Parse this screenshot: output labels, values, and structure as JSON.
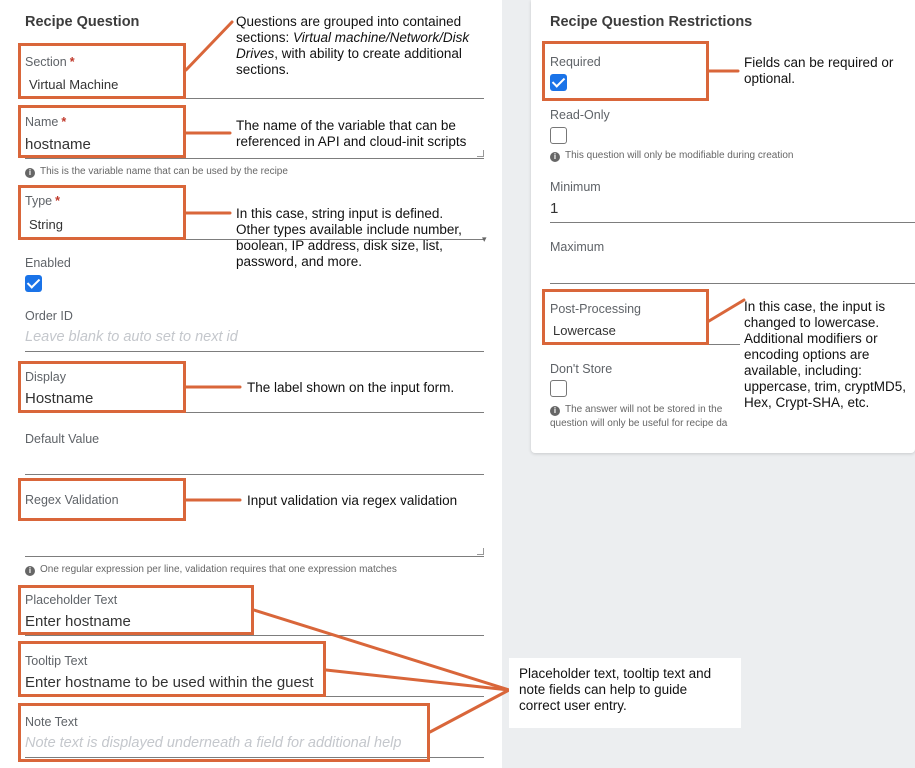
{
  "left": {
    "title": "Recipe Question",
    "section": {
      "label": "Section",
      "required_mark": "*",
      "value": "Virtual Machine"
    },
    "name": {
      "label": "Name",
      "required_mark": "*",
      "value": "hostname",
      "help": "This is the variable name that can be used by the recipe"
    },
    "type": {
      "label": "Type",
      "required_mark": "*",
      "value": "String"
    },
    "enabled": {
      "label": "Enabled",
      "checked": true
    },
    "order_id": {
      "label": "Order ID",
      "placeholder": "Leave blank to auto set to next id"
    },
    "display": {
      "label": "Display",
      "value": "Hostname"
    },
    "default_value": {
      "label": "Default Value",
      "value": ""
    },
    "regex": {
      "label": "Regex Validation",
      "help": "One regular expression per line, validation requires that one expression matches"
    },
    "placeholder_text": {
      "label": "Placeholder Text",
      "value": "Enter hostname"
    },
    "tooltip_text": {
      "label": "Tooltip Text",
      "value": "Enter hostname to be used within the guest"
    },
    "note_text": {
      "label": "Note Text",
      "placeholder": "Note text is displayed underneath a field for additional help"
    }
  },
  "right": {
    "title": "Recipe Question Restrictions",
    "required": {
      "label": "Required",
      "checked": true
    },
    "read_only": {
      "label": "Read-Only",
      "checked": false,
      "help": "This question will only be modifiable during creation"
    },
    "minimum": {
      "label": "Minimum",
      "value": "1"
    },
    "maximum": {
      "label": "Maximum",
      "value": ""
    },
    "post_processing": {
      "label": "Post-Processing",
      "value": "Lowercase"
    },
    "dont_store": {
      "label": "Don't Store",
      "checked": false,
      "help_line1": "The answer will not be stored in the",
      "help_line2": "question will only be useful for recipe da"
    }
  },
  "annotations": {
    "sections": {
      "pre": "Questions are grouped into contained sections: ",
      "italic": "Virtual machine/Network/Disk Drives",
      "post": ", with ability to create additional sections."
    },
    "name": "The name of the variable that can be referenced in API and cloud-init scripts",
    "type": "In this case, string input is defined. Other types available include number, boolean, IP address, disk size, list, password, and more.",
    "display": "The label shown on the input form.",
    "regex": "Input validation via regex validation",
    "required": "Fields can be required or optional.",
    "post_processing": "In this case, the input is changed to lowercase. Additional modifiers or encoding options are available, including: uppercase, trim, cryptMD5,  Hex, Crypt-SHA, etc.",
    "helper_fields": "Placeholder text, tooltip text and note fields can help to guide correct user entry."
  },
  "colors": {
    "annotation_orange": "#d9663a",
    "checkbox_blue": "#1a73e8",
    "background_gray": "#eceef0"
  }
}
